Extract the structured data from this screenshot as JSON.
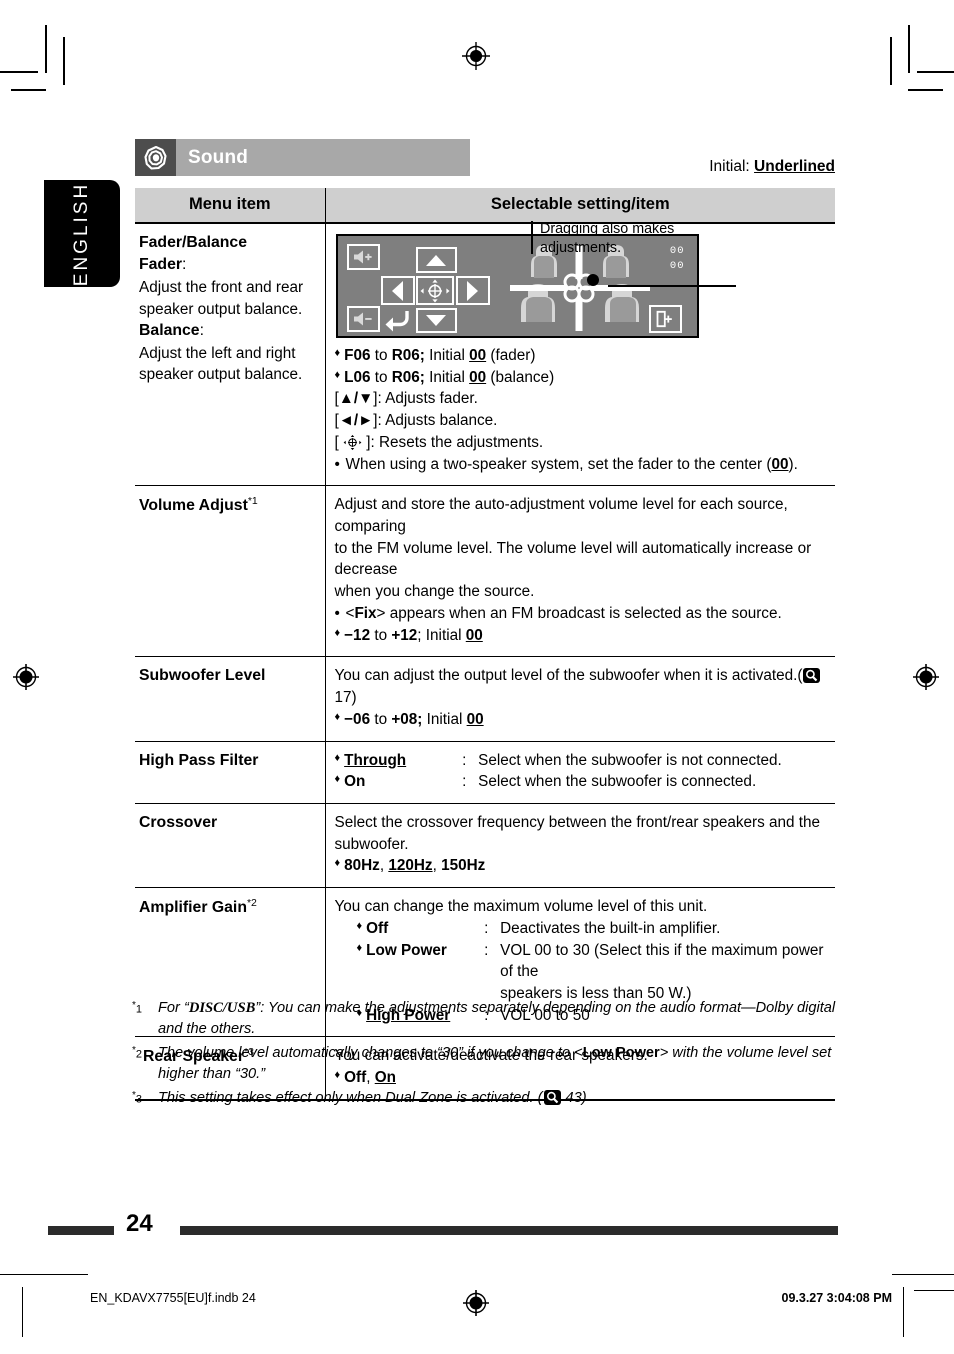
{
  "language_tab": {
    "label": "ENGLISH"
  },
  "section_header": {
    "title": "Sound",
    "icon": "sound-speaker-icon"
  },
  "initial_note": {
    "prefix": "Initial: ",
    "value": "Underlined"
  },
  "table": {
    "headers": {
      "menu_item": "Menu item",
      "selectable": "Selectable setting/item"
    },
    "rows": [
      {
        "menu": {
          "title": "Fader/Balance",
          "lines": [
            {
              "text": "Fader",
              "bold": true,
              "suffix": ":"
            },
            {
              "text": "Adjust the front and rear",
              "bold": false
            },
            {
              "text": "speaker output balance.",
              "bold": false
            },
            {
              "text": "Balance",
              "bold": true,
              "suffix": ":"
            },
            {
              "text": "Adjust the left and right",
              "bold": false
            },
            {
              "text": "speaker output balance.",
              "bold": false
            }
          ]
        },
        "device_screen": {
          "buttons": [
            "volume-up-icon",
            "up-arrow-button",
            "left-arrow-button",
            "reset-center-button",
            "right-arrow-button",
            "volume-down-icon",
            "back-return-button",
            "down-arrow-button",
            "exit-button"
          ],
          "readout_top": "00",
          "readout_bottom": "00"
        },
        "callout": "Dragging also makes adjustments.",
        "setting_lines": [
          "♦ F06 to R06; Initial 00 (fader)",
          "♦ L06 to R06; Initial 00 (balance)",
          "[▲/▼]: Adjusts fader.",
          "[◄/►]: Adjusts balance.",
          "[ ⊕ ]: Resets the adjustments.",
          "• When using a two-speaker system, set the fader to the center (00)."
        ]
      },
      {
        "menu": {
          "title": "Volume Adjust",
          "footnote": "*1"
        },
        "setting_lines": [
          "Adjust and store the auto-adjustment volume level for each source, comparing",
          "to the FM volume level. The volume level will automatically increase or decrease",
          "when you change the source.",
          "• <Fix> appears when an FM broadcast is selected as the source.",
          "♦ ‒12 to +12; Initial 00"
        ]
      },
      {
        "menu": {
          "title": "Subwoofer Level"
        },
        "setting_lines": [
          "You can adjust the output level of the subwoofer when it is activated.(  17)",
          "♦ ‒06 to +08; Initial 00"
        ]
      },
      {
        "menu": {
          "title": "High Pass Filter"
        },
        "options": [
          {
            "name": "Through",
            "underlined": true,
            "colon": ":",
            "desc": "Select when the subwoofer is not connected."
          },
          {
            "name": "On",
            "underlined": false,
            "colon": ":",
            "desc": "Select when the subwoofer is connected."
          }
        ]
      },
      {
        "menu": {
          "title": "Crossover"
        },
        "setting_lines": [
          "Select the crossover frequency between the front/rear speakers and the",
          "subwoofer.",
          "♦ 80Hz, 120Hz, 150Hz"
        ]
      },
      {
        "menu": {
          "title": "Amplifier Gain",
          "footnote": "*2"
        },
        "intro": "You can change the maximum volume level of this unit.",
        "options": [
          {
            "name": "Off",
            "underlined": false,
            "colon": ":",
            "desc": "Deactivates the built-in amplifier."
          },
          {
            "name": "Low Power",
            "underlined": false,
            "colon": ":",
            "desc": "VOL 00 to 30 (Select this if the maximum power of the"
          },
          {
            "name": "",
            "underlined": false,
            "colon": "",
            "desc": "speakers is less than 50 W.)"
          },
          {
            "name": "High Power",
            "underlined": true,
            "colon": ":",
            "desc": "VOL 00 to 50"
          }
        ]
      },
      {
        "menu": {
          "title": "Rear Speaker",
          "footnote": "*3"
        },
        "setting_lines": [
          "You can activate/deactivate the rear speakers.",
          "♦ Off, On"
        ]
      }
    ]
  },
  "footnotes": [
    {
      "mark": "*1",
      "text": "For “DISC/USB”: You can make the adjustments separately depending on the audio format—Dolby digital and the others."
    },
    {
      "mark": "*2",
      "text": "The volume level automatically changes to “30” if you change to <Low Power> with the volume level set higher than “30.”"
    },
    {
      "mark": "*3",
      "text": "This setting takes effect only when Dual Zone is activated. (  43)"
    }
  ],
  "footer": {
    "page_number": "24"
  },
  "slug": {
    "left": "EN_KDAVX7755[EU]f.indb   24",
    "right": "09.3.27   3:04:08 PM"
  },
  "colors": {
    "header_bar": "#a8a8a8",
    "header_icon_box": "#4d4d4d",
    "table_header": "#cfcfcf",
    "device_screen": "#7f7f7f",
    "footer_bar": "#2b2b2b"
  }
}
